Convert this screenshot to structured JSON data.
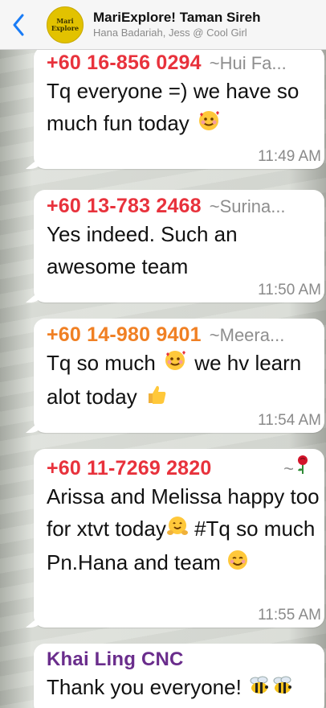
{
  "header": {
    "title": "MariExplore! Taman Sireh",
    "subtitle": "Hana Badariah, Jess @ Cool Girl",
    "avatar_text": "Mari Explore",
    "back_icon": "chevron-left-icon"
  },
  "colors": {
    "red": "#e8323c",
    "orange": "#f08024",
    "purple": "#6a2d8c",
    "link_blue": "#1a7cf6"
  },
  "messages": [
    {
      "sender": "+60 16-856 0294",
      "alias": "~Hui Fa...",
      "sender_color": "red",
      "text_before": "Tq everyone =) we have so much fun today",
      "emoji": "smiling-face-with-hearts",
      "time": "11:49 AM"
    },
    {
      "sender": "+60 13-783 2468",
      "alias": "~Surina...",
      "sender_color": "red",
      "text_before": "Yes indeed. Such an awesome team",
      "time": "11:50 AM"
    },
    {
      "sender": "+60 14-980 9401",
      "alias": "~Meera...",
      "sender_color": "orange",
      "text_before": "Tq so much",
      "emoji": "smiling-face-with-hearts",
      "text_after": "we hv learn alot today",
      "emoji2": "thumbs-up",
      "time": "11:54 AM"
    },
    {
      "sender": "+60 11-7269 2820",
      "alias": "~",
      "alias_emoji": "rose",
      "sender_color": "red",
      "text_before": "Arissa and Melissa happy too for xtvt today",
      "emoji": "hugging-face",
      "text_after": "#Tq so much Pn.Hana and team",
      "emoji2": "smiling-face",
      "time": "11:55 AM"
    },
    {
      "sender": "Khai Ling CNC",
      "sender_color": "purple",
      "text_before": "Thank you everyone!",
      "emoji": "bee",
      "emoji2": "bee"
    }
  ]
}
